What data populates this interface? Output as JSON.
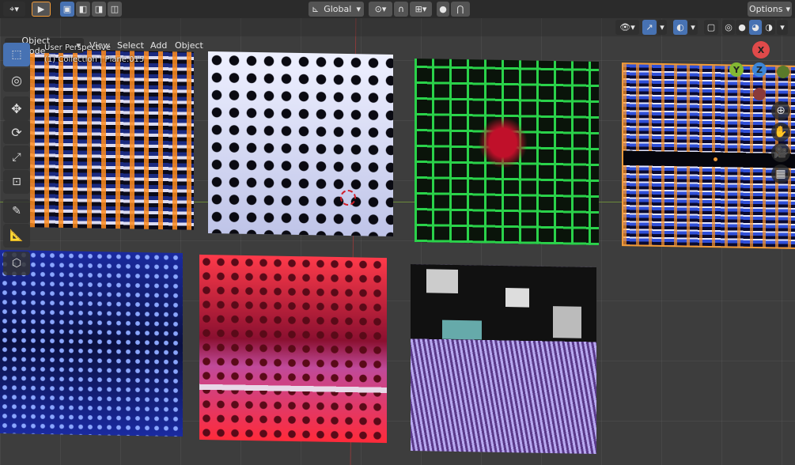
{
  "header": {
    "transform_orientation": "Global",
    "options_label": "Options"
  },
  "menubar": {
    "mode_label": "Object Mode",
    "items": [
      "View",
      "Select",
      "Add",
      "Object"
    ]
  },
  "overlay_info": {
    "view_name": "User Perspective",
    "collection_info": "(1) Collection | Plane.015"
  },
  "navigation_gizmo": {
    "x_label": "X",
    "y_label": "Y",
    "z_label": "Z"
  },
  "toolbar": {
    "tools": [
      "select-box",
      "cursor",
      "move",
      "rotate",
      "scale",
      "transform",
      "annotate",
      "measure",
      "add-cube"
    ]
  },
  "colors": {
    "active_tool": "#4772b3",
    "selected_outline": "#f29b38",
    "x_axis": "#e04a4a",
    "y_axis": "#84b833",
    "z_axis": "#3d86d8"
  }
}
